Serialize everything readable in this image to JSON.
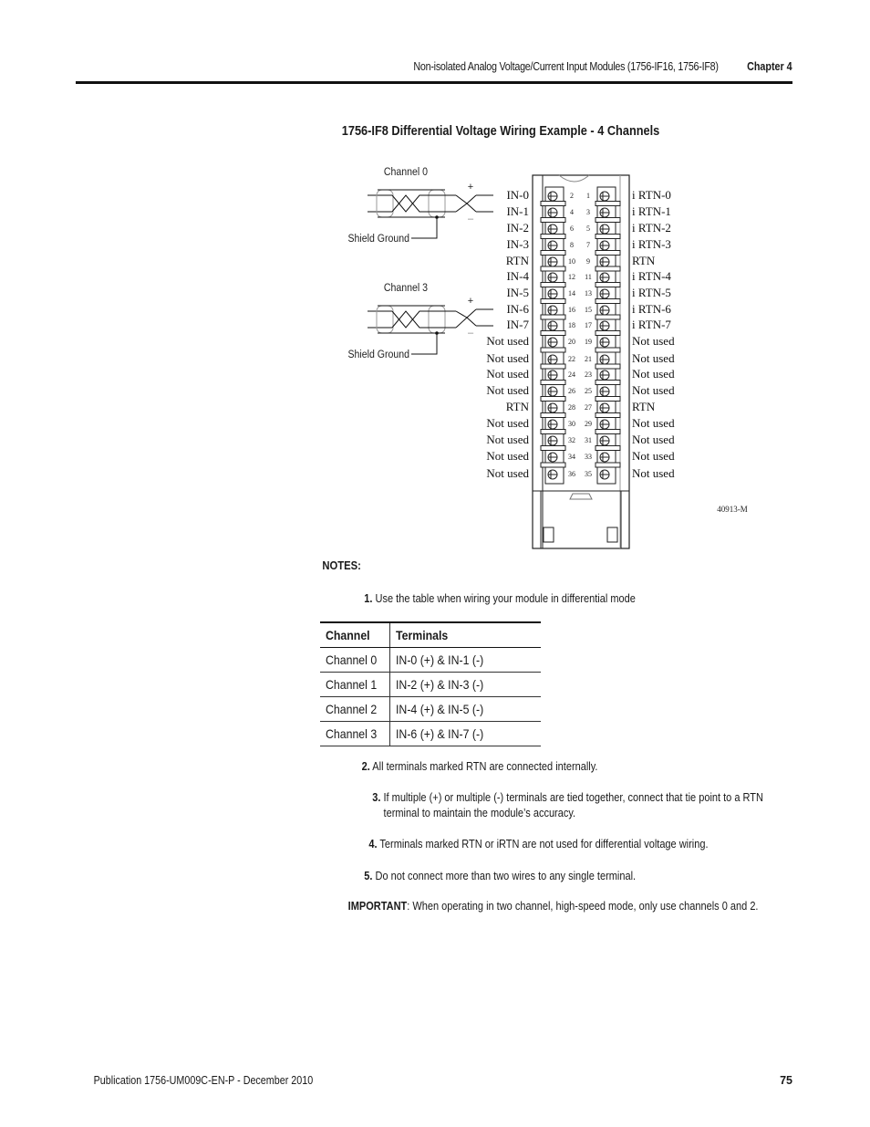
{
  "header": {
    "running_title": "Non-isolated Analog Voltage/Current Input Modules (1756-IF16, 1756-IF8)",
    "chapter": "Chapter 4"
  },
  "figure": {
    "title": "1756-IF8 Differential Voltage Wiring Example - 4 Channels",
    "figure_id": "40913-M",
    "cable_labels": {
      "channel_0": "Channel 0",
      "channel_3": "Channel 3",
      "shield_ground": "Shield Ground",
      "plus": "+",
      "minus": "–"
    },
    "terminals": [
      {
        "left_label": "IN-0",
        "left_num": "2",
        "right_num": "1",
        "right_label": "i RTN-0"
      },
      {
        "left_label": "IN-1",
        "left_num": "4",
        "right_num": "3",
        "right_label": "i RTN-1"
      },
      {
        "left_label": "IN-2",
        "left_num": "6",
        "right_num": "5",
        "right_label": "i RTN-2"
      },
      {
        "left_label": "IN-3",
        "left_num": "8",
        "right_num": "7",
        "right_label": "i RTN-3"
      },
      {
        "left_label": "RTN",
        "left_num": "10",
        "right_num": "9",
        "right_label": "RTN"
      },
      {
        "left_label": "IN-4",
        "left_num": "12",
        "right_num": "11",
        "right_label": "i RTN-4"
      },
      {
        "left_label": "IN-5",
        "left_num": "14",
        "right_num": "13",
        "right_label": "i RTN-5"
      },
      {
        "left_label": "IN-6",
        "left_num": "16",
        "right_num": "15",
        "right_label": "i RTN-6"
      },
      {
        "left_label": "IN-7",
        "left_num": "18",
        "right_num": "17",
        "right_label": "i RTN-7"
      },
      {
        "left_label": "Not used",
        "left_num": "20",
        "right_num": "19",
        "right_label": "Not used"
      },
      {
        "left_label": "Not used",
        "left_num": "22",
        "right_num": "21",
        "right_label": "Not used"
      },
      {
        "left_label": "Not used",
        "left_num": "24",
        "right_num": "23",
        "right_label": "Not used"
      },
      {
        "left_label": "Not used",
        "left_num": "26",
        "right_num": "25",
        "right_label": "Not used"
      },
      {
        "left_label": "RTN",
        "left_num": "28",
        "right_num": "27",
        "right_label": "RTN"
      },
      {
        "left_label": "Not used",
        "left_num": "30",
        "right_num": "29",
        "right_label": "Not used"
      },
      {
        "left_label": "Not used",
        "left_num": "32",
        "right_num": "31",
        "right_label": "Not used"
      },
      {
        "left_label": "Not used",
        "left_num": "34",
        "right_num": "33",
        "right_label": "Not used"
      },
      {
        "left_label": "Not used",
        "left_num": "36",
        "right_num": "35",
        "right_label": "Not used"
      }
    ]
  },
  "notes": {
    "title": "NOTES:",
    "items": [
      {
        "num": "1.",
        "text": "Use the table  when wiring your module in differential mode"
      },
      {
        "num": "2.",
        "text": "All terminals marked RTN are connected internally."
      },
      {
        "num": "3.",
        "text": "If multiple (+) or multiple (-) terminals are tied together, connect that tie point to a RTN",
        "text2": "terminal to maintain the module’s accuracy."
      },
      {
        "num": "4.",
        "text": "Terminals marked RTN or iRTN are not used for differential voltage wiring."
      },
      {
        "num": "5.",
        "text": "Do not connect more than two wires to any single terminal."
      }
    ],
    "important_label": "IMPORTANT",
    "important_text": ": When operating in two channel, high-speed mode, only use channels 0 and 2."
  },
  "channel_table": {
    "headers": [
      "Channel",
      "Terminals"
    ],
    "rows": [
      [
        "Channel 0",
        "IN-0 (+) & IN-1 (-)"
      ],
      [
        "Channel 1",
        "IN-2 (+) & IN-3 (-)"
      ],
      [
        "Channel 2",
        "IN-4 (+) & IN-5 (-)"
      ],
      [
        "Channel 3",
        "IN-6 (+) & IN-7 (-)"
      ]
    ]
  },
  "footer": {
    "publication": "Publication 1756-UM009C-EN-P - December 2010",
    "page_number": "75"
  }
}
